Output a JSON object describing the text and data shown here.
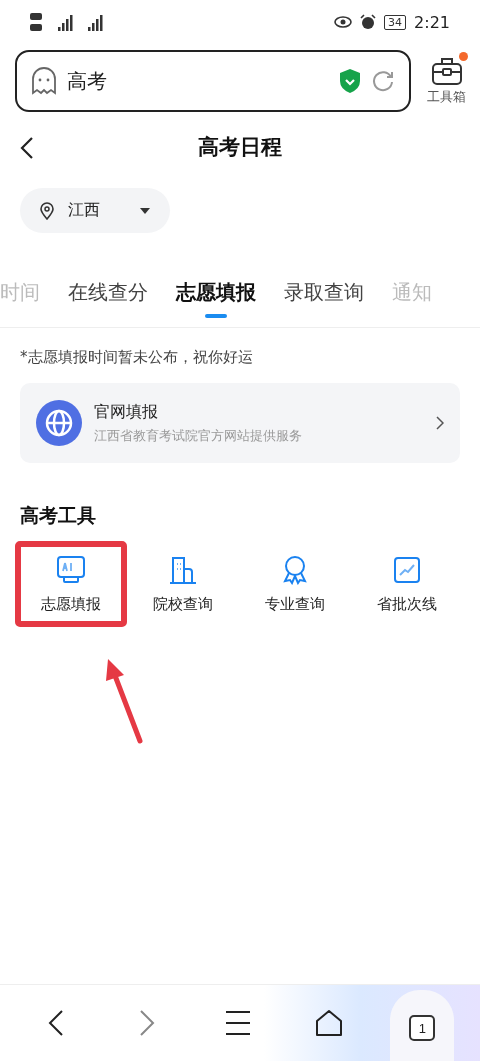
{
  "status_bar": {
    "time": "2:21",
    "battery": "34"
  },
  "search": {
    "value": "高考"
  },
  "toolbox": {
    "label": "工具箱",
    "badge": true
  },
  "header": {
    "title": "高考日程"
  },
  "location": {
    "value": "江西"
  },
  "tabs": [
    {
      "label": "时间",
      "selected": false
    },
    {
      "label": "在线查分",
      "selected": false
    },
    {
      "label": "志愿填报",
      "selected": true
    },
    {
      "label": "录取查询",
      "selected": false
    },
    {
      "label": "通知",
      "selected": false
    }
  ],
  "notice": "*志愿填报时间暂未公布，祝你好运",
  "service_card": {
    "title": "官网填报",
    "subtitle": "江西省教育考试院官方网站提供服务"
  },
  "tools": {
    "title": "高考工具",
    "items": [
      {
        "kind": "ai",
        "label": "志愿填报",
        "highlighted": true
      },
      {
        "kind": "school",
        "label": "院校查询",
        "highlighted": false
      },
      {
        "kind": "major",
        "label": "专业查询",
        "highlighted": false
      },
      {
        "kind": "line",
        "label": "省批次线",
        "highlighted": false
      }
    ]
  },
  "bottom_nav": {
    "tab_count": "1"
  }
}
